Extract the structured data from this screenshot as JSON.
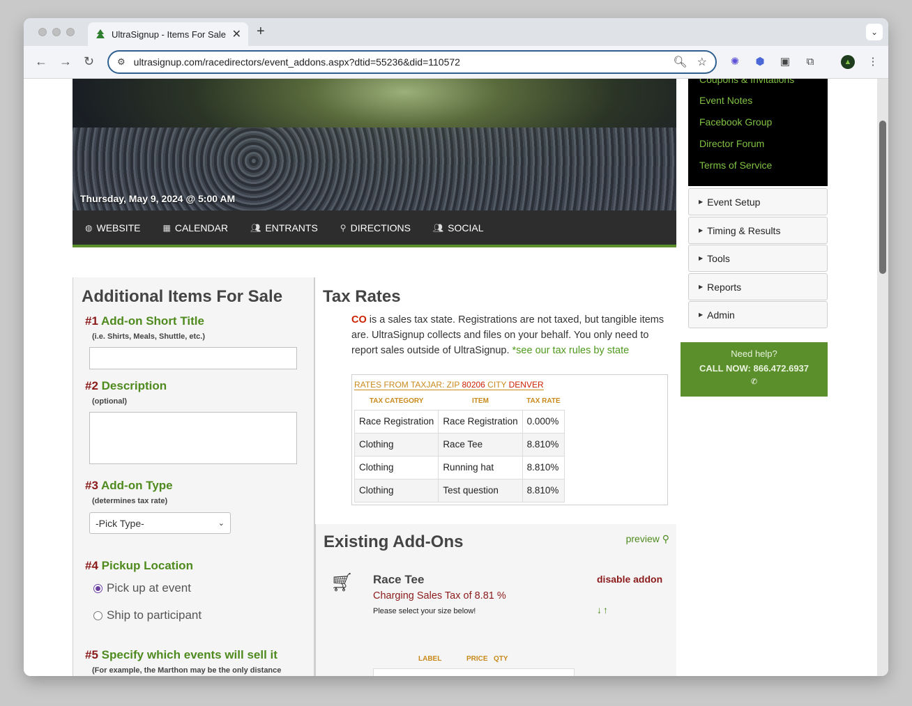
{
  "browser": {
    "tab_title": "UltraSignup - Items For Sale",
    "url": "ultrasignup.com/racedirectors/event_addons.aspx?dtid=55236&did=110572",
    "icons": [
      "back-icon",
      "forward-icon",
      "reload-icon",
      "site-settings-icon",
      "zoom-icon",
      "bookmark-star-icon",
      "extension-icon",
      "profile-avatar-icon",
      "more-menu-icon"
    ]
  },
  "hero": {
    "date": "Thursday, May 9, 2024 @ 5:00 AM"
  },
  "event_nav": {
    "items": [
      {
        "label": "WEBSITE",
        "icon": "globe-icon"
      },
      {
        "label": "CALENDAR",
        "icon": "calendar-icon"
      },
      {
        "label": "ENTRANTS",
        "icon": "users-icon"
      },
      {
        "label": "DIRECTIONS",
        "icon": "map-pin-icon"
      },
      {
        "label": "SOCIAL",
        "icon": "users-icon"
      }
    ]
  },
  "sidebar": {
    "links": [
      "Coupons & Invitations",
      "Event Notes",
      "Facebook Group",
      "Director Forum",
      "Terms of Service"
    ],
    "sections": [
      "Event Setup",
      "Timing & Results",
      "Tools",
      "Reports",
      "Admin"
    ],
    "help": {
      "title": "Need help?",
      "phone": "CALL NOW: 866.472.6937"
    }
  },
  "form": {
    "title": "Additional Items For Sale",
    "steps": [
      {
        "num": "#1",
        "label": "Add-on Short Title",
        "hint": "(i.e. Shirts, Meals, Shuttle, etc.)"
      },
      {
        "num": "#2",
        "label": "Description",
        "hint": "(optional)"
      },
      {
        "num": "#3",
        "label": "Add-on Type",
        "hint": "(determines tax rate)"
      },
      {
        "num": "#4",
        "label": "Pickup Location",
        "hint": ""
      },
      {
        "num": "#5",
        "label": "Specify which events will sell it",
        "hint": "(For example, the Marthon may be the only distance"
      }
    ],
    "type_select_value": "-Pick Type-",
    "pickup_options": [
      {
        "label": "Pick up at event",
        "selected": true
      },
      {
        "label": "Ship to participant",
        "selected": false
      }
    ]
  },
  "tax": {
    "title": "Tax Rates",
    "state": "CO",
    "desc": " is a sales tax state. Registrations are not taxed, but tangible items are. UltraSignup collects and files on your behalf. You only need to report sales outside of UltraSignup. ",
    "link": "*see our tax rules by state",
    "rates_from": "RATES FROM TAXJAR: ZIP ",
    "zip": "80206",
    "city_label": " CITY ",
    "city": "DENVER",
    "columns": [
      "TAX CATEGORY",
      "ITEM",
      "TAX RATE"
    ],
    "rows": [
      [
        "Race Registration",
        "Race Registration",
        "0.000%"
      ],
      [
        "Clothing",
        "Race Tee",
        "8.810%"
      ],
      [
        "Clothing",
        "Running hat",
        "8.810%"
      ],
      [
        "Clothing",
        "Test question",
        "8.810%"
      ]
    ]
  },
  "existing": {
    "title": "Existing Add-Ons",
    "preview": "preview",
    "addon": {
      "name": "Race Tee",
      "tax": "Charging Sales Tax of 8.81 %",
      "desc": "Please select your size below!",
      "disable": "disable addon"
    },
    "options_columns": [
      "LABEL",
      "PRICE",
      "QTY"
    ]
  },
  "colors": {
    "brand_green": "#5a8f2b",
    "link_green": "#4e8a1e",
    "step_red": "#8b1a1a",
    "taxjar_orange": "#c98a1c"
  }
}
